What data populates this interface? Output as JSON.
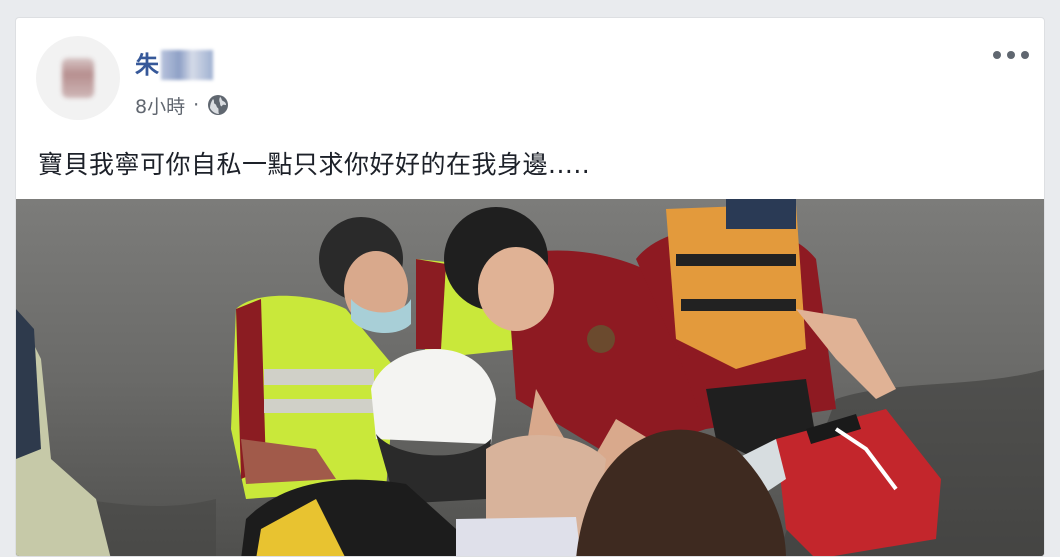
{
  "post": {
    "author_name": "朱",
    "timestamp": "8小時",
    "separator": "·",
    "privacy_icon": "globe-icon",
    "more_icon": "more-options-icon",
    "text": "寶貝我寧可你自私一點只求你好好的在我身邊....."
  },
  "colors": {
    "author": "#365899",
    "meta": "#616770",
    "body_text": "#1d2129",
    "background": "#e9ebee"
  }
}
